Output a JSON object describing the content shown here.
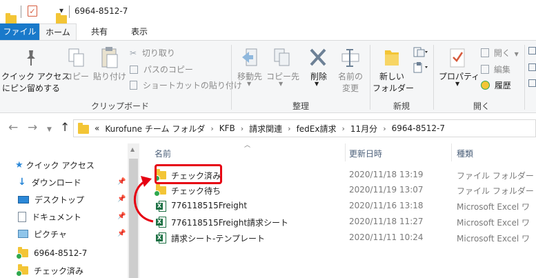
{
  "window": {
    "title": "6964-8512-7",
    "qa_dropdown": "▾"
  },
  "tabs": {
    "file": "ファイル",
    "home": "ホーム",
    "share": "共有",
    "view": "表示"
  },
  "ribbon": {
    "clipboard": {
      "label": "クリップボード",
      "pin_quick": [
        "クイック アクセス",
        "にピン留めする"
      ],
      "copy": "コピー",
      "paste": "貼り付け",
      "cut": "切り取り",
      "copy_path": "パスのコピー",
      "paste_shortcut": "ショートカットの貼り付け"
    },
    "organize": {
      "label": "整理",
      "move_to": "移動先",
      "copy_to": "コピー先",
      "delete": "削除",
      "rename": [
        "名前の",
        "変更"
      ]
    },
    "new": {
      "label": "新規",
      "new_folder": [
        "新しい",
        "フォルダー"
      ]
    },
    "open": {
      "label": "開く",
      "properties": "プロパティ",
      "open": "開く",
      "edit": "編集",
      "history": "履歴"
    }
  },
  "address": {
    "overflow": "«",
    "crumbs": [
      "Kurofune チーム フォルダ",
      "KFB",
      "請求関連",
      "fedEx請求",
      "11月分",
      "6964-8512-7"
    ],
    "separator": "›"
  },
  "nav_pane": {
    "items": [
      {
        "label": "クイック アクセス",
        "icon": "star-icon"
      },
      {
        "label": "ダウンロード",
        "icon": "download-icon"
      },
      {
        "label": "デスクトップ",
        "icon": "desktop-icon"
      },
      {
        "label": "ドキュメント",
        "icon": "document-icon"
      },
      {
        "label": "ピクチャ",
        "icon": "pictures-icon"
      },
      {
        "label": "6964-8512-7",
        "icon": "folder-icon"
      },
      {
        "label": "チェック済み",
        "icon": "folder-icon"
      }
    ]
  },
  "file_list": {
    "columns": {
      "name": "名前",
      "date": "更新日時",
      "type": "種類"
    },
    "rows": [
      {
        "name": "チェック済み",
        "date": "2020/11/18 13:19",
        "type": "ファイル フォルダー",
        "icon": "folder-icon"
      },
      {
        "name": "チェック待ち",
        "date": "2020/11/19 13:07",
        "type": "ファイル フォルダー",
        "icon": "folder-icon"
      },
      {
        "name": "776118515Freight",
        "date": "2020/11/16 13:18",
        "type": "Microsoft Excel ワ",
        "icon": "excel-icon"
      },
      {
        "name": "776118515Freight請求シート",
        "date": "2020/11/18 11:27",
        "type": "Microsoft Excel ワ",
        "icon": "excel-icon"
      },
      {
        "name": "請求シート-テンプレート",
        "date": "2020/11/11 10:24",
        "type": "Microsoft Excel ワ",
        "icon": "excel-icon"
      }
    ]
  },
  "colors": {
    "file_tab": "#1979ca",
    "highlight": "#e60012",
    "folder": "#f3c536",
    "excel": "#1e7145"
  }
}
